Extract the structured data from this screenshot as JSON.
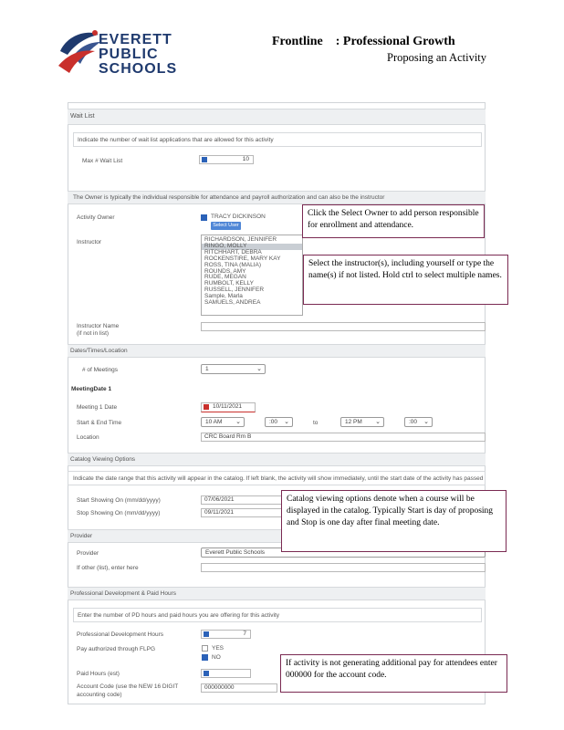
{
  "header": {
    "logo_lines": [
      "EVERETT",
      "PUBLIC",
      "SCHOOLS"
    ],
    "title": "Frontline    : Professional Growth",
    "subtitle": "Proposing an Activity"
  },
  "wait_list": {
    "section": "Wait List",
    "instruction": "Indicate the number of wait list applications that are allowed for this activity",
    "max_label": "Max # Wait List",
    "max_value": "10"
  },
  "owner": {
    "note": "The Owner is typically the individual responsible for attendance and payroll authorization and can also be the instructor",
    "label": "Activity Owner",
    "owner_name": "TRACY DICKINSON",
    "select_user": "Select User"
  },
  "instructor": {
    "label": "Instructor",
    "names": [
      "RICHARDSON, JENNIFER",
      "RINGO, MOLLY",
      "RITCHHART, DEBRA",
      "ROCKENSTIRE, MARY KAY",
      "ROSS, TINA (MALIA)",
      "ROUNDS, AMY",
      "RUDE, MEGAN",
      "RUMBOLT, KELLY",
      "RUSSELL, JENNIFER",
      "Sample, Marla",
      "SAMUELS, ANDREA"
    ],
    "selected_index": 1,
    "name_label": "Instructor Name",
    "name_sublabel": "(if not in list)"
  },
  "dates": {
    "section": "Dates/Times/Location",
    "meetings_label": "# of Meetings",
    "meetings_value": "1",
    "meeting_date_heading": "MeetingDate 1",
    "date_label": "Meeting 1 Date",
    "date_value": "10/11/2021",
    "time_label": "Start & End Time",
    "start_hour": "10 AM",
    "start_min": ":00",
    "to": "to",
    "end_hour": "12 PM",
    "end_min": ":00",
    "location_label": "Location",
    "location_value": "CRC Board Rm B"
  },
  "catalog": {
    "section": "Catalog Viewing Options",
    "instruction": "Indicate the date range that this activity will appear in the catalog. If left blank, the activity will show immediately, until the start date of the activity has passed",
    "start_label": "Start Showing On (mm/dd/yyyy)",
    "start_value": "07/06/2021",
    "stop_label": "Stop Showing On (mm/dd/yyyy)",
    "stop_value": "09/11/2021"
  },
  "provider": {
    "section": "Provider",
    "label": "Provider",
    "value": "Everett Public Schools",
    "other_label": "If other (list), enter here"
  },
  "pd": {
    "section": "Professional Development & Paid Hours",
    "instruction": "Enter the number of PD hours and paid hours you are offering for this activity",
    "hours_label": "Professional Development Hours",
    "hours_value": "7",
    "pay_label": "Pay authorized through FLPG",
    "yes": "YES",
    "no": "NO",
    "paid_label": "Paid Hours (est)",
    "paid_value": "",
    "account_label_1": "Account Code (use the NEW 16 DIGIT",
    "account_label_2": "accounting code)",
    "account_value": "000000000"
  },
  "callouts": {
    "owner": "Click the Select Owner to add person responsible for enrollment and attendance.",
    "instructor": "Select the instructor(s), including yourself or type the name(s) if not listed. Hold ctrl to select multiple names.",
    "catalog": "Catalog viewing options denote when a course will be displayed in the catalog. Typically Start is day of proposing and Stop is one day after final meeting date.",
    "pay": "If activity is not generating additional pay for attendees enter 000000 for the account code."
  },
  "colors": {
    "callout_border": "#7a2a52",
    "logo_blue": "#1f3a6e",
    "accent_red": "#c9302c"
  }
}
